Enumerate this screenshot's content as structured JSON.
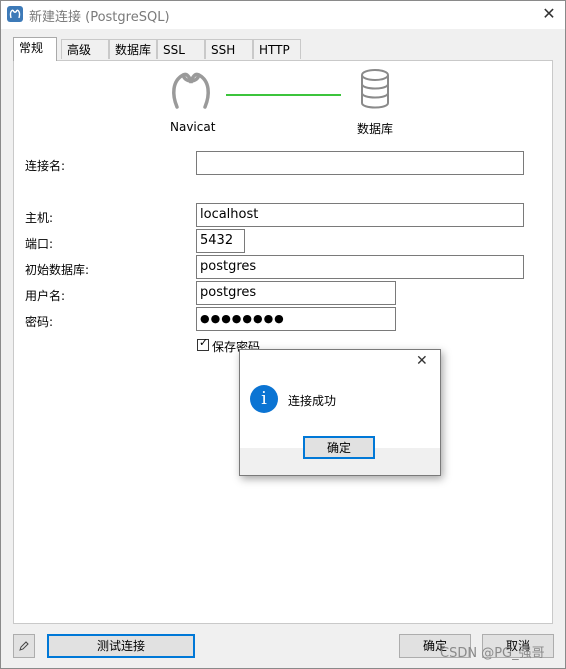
{
  "window": {
    "title": "新建连接 (PostgreSQL)",
    "close_glyph": "✕"
  },
  "tabs": [
    "常规",
    "高级",
    "数据库",
    "SSL",
    "SSH",
    "HTTP"
  ],
  "diagram": {
    "left_label": "Navicat",
    "right_label": "数据库",
    "connector_color": "#3cc43c"
  },
  "form": {
    "connection_name": {
      "label": "连接名:",
      "value": ""
    },
    "host": {
      "label": "主机:",
      "value": "localhost"
    },
    "port": {
      "label": "端口:",
      "value": "5432"
    },
    "initial_db": {
      "label": "初始数据库:",
      "value": "postgres"
    },
    "username": {
      "label": "用户名:",
      "value": "postgres"
    },
    "password": {
      "label": "密码:",
      "value": "●●●●●●●●"
    },
    "save_password": {
      "label": "保存密码",
      "checked": true
    }
  },
  "dialog": {
    "message": "连接成功",
    "ok_label": "确定",
    "info_glyph": "i",
    "close_glyph": "✕"
  },
  "footer": {
    "test_button": "测试连接",
    "ok_button": "确定",
    "cancel_button": "取消"
  },
  "watermark": "CSDN @PG_强哥"
}
